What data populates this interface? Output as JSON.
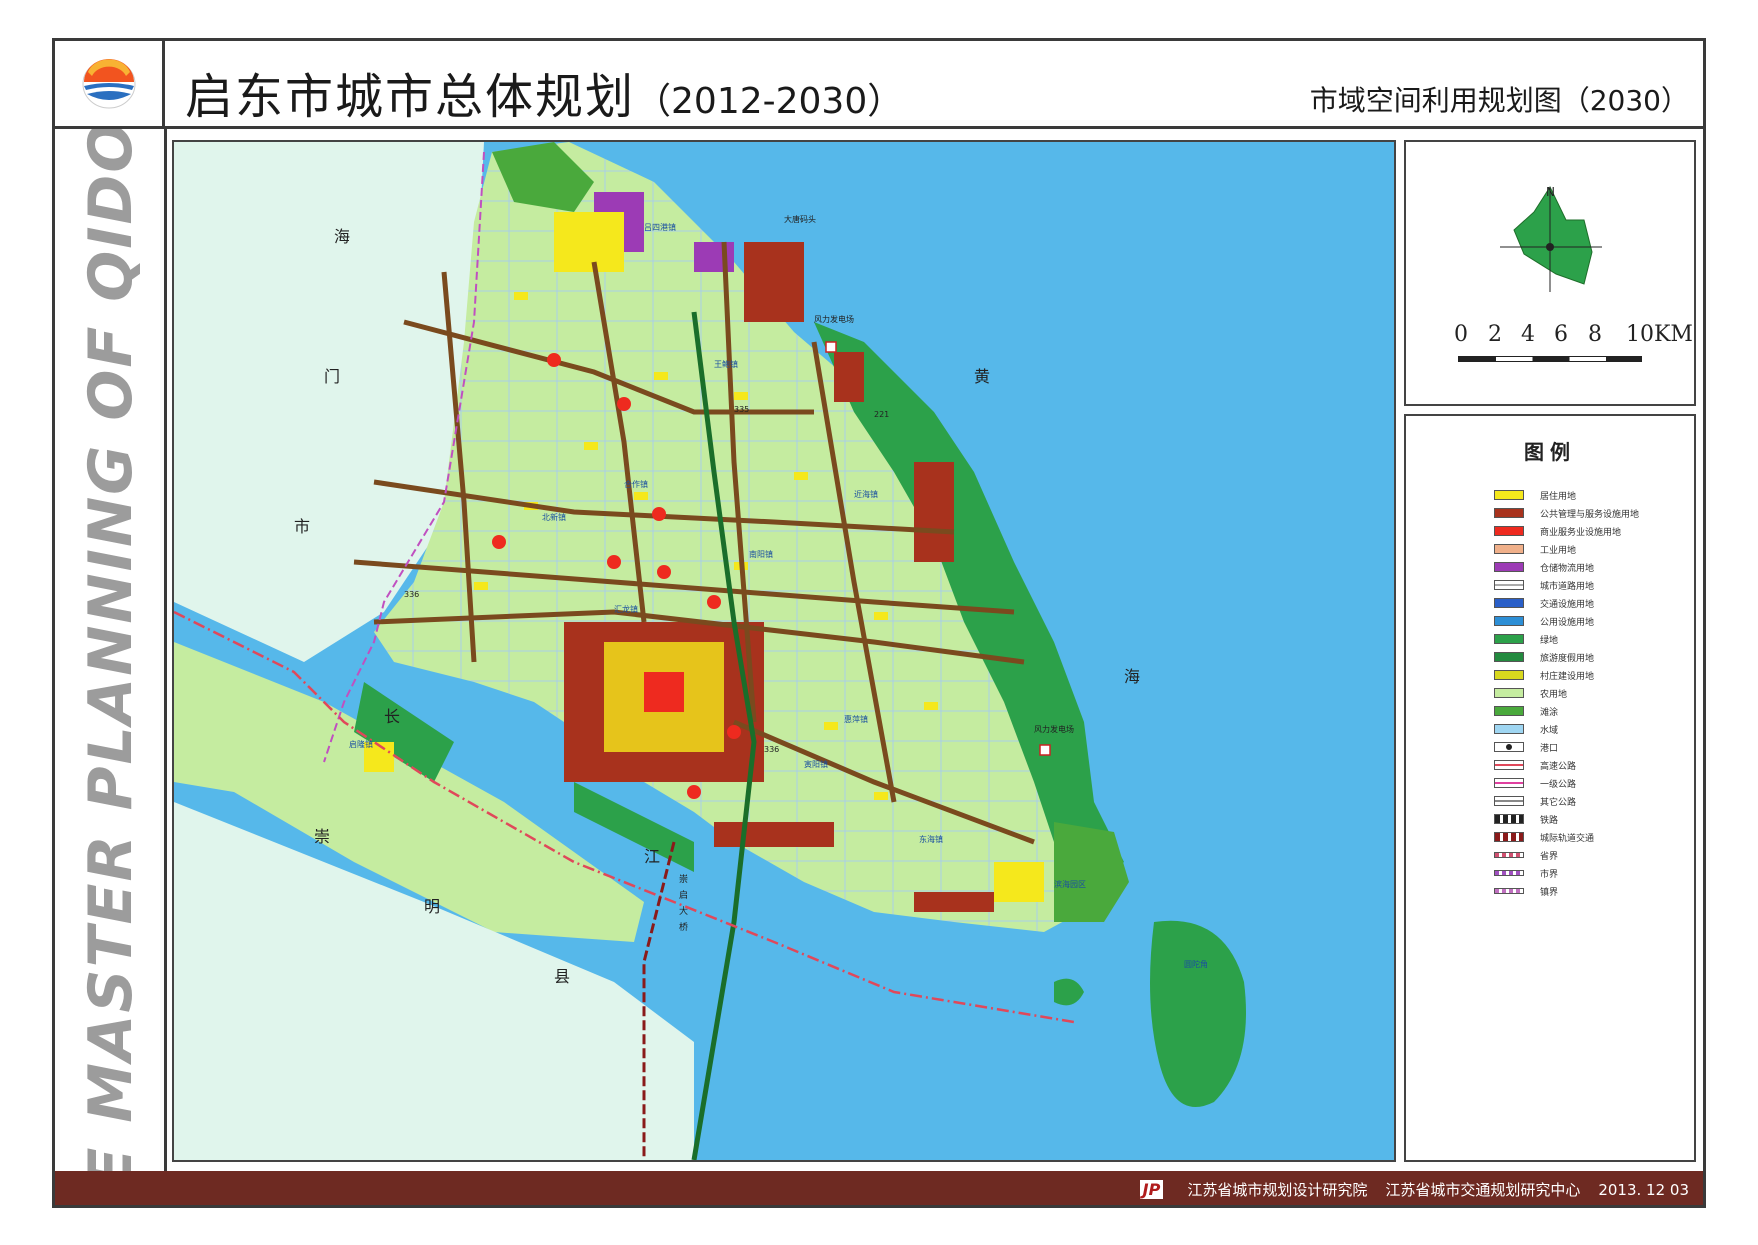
{
  "header": {
    "title": "启东市城市总体规划",
    "years": "（2012-2030）",
    "subtitle": "市域空间利用规划图（2030）"
  },
  "side_banner": "THE MASTER PLANNING OF QIDONG",
  "compass": {
    "north": "N",
    "scale_ticks": [
      "0",
      "2",
      "4",
      "6",
      "8",
      "10KM"
    ]
  },
  "legend": {
    "title": "图例",
    "items": [
      {
        "label": "居住用地",
        "color": "#f5e81c",
        "style": "fill"
      },
      {
        "label": "公共管理与服务设施用地",
        "color": "#a8321d",
        "style": "fill"
      },
      {
        "label": "商业服务业设施用地",
        "color": "#ee2a1f",
        "style": "fill"
      },
      {
        "label": "工业用地",
        "color": "#f0b08a",
        "style": "fill"
      },
      {
        "label": "仓储物流用地",
        "color": "#9c3bb5",
        "style": "fill"
      },
      {
        "label": "城市道路用地",
        "color": "#ffffff",
        "style": "road"
      },
      {
        "label": "交通设施用地",
        "color": "#2a5fc8",
        "style": "fill"
      },
      {
        "label": "公用设施用地",
        "color": "#2d8fd6",
        "style": "fill"
      },
      {
        "label": "绿地",
        "color": "#2ca14a",
        "style": "fill"
      },
      {
        "label": "旅游度假用地",
        "color": "#238a3f",
        "style": "fill"
      },
      {
        "label": "村庄建设用地",
        "color": "#d8d81e",
        "style": "fill"
      },
      {
        "label": "农用地",
        "color": "#c5eca0",
        "style": "fill"
      },
      {
        "label": "滩涂",
        "color": "#4aa93c",
        "style": "fill"
      },
      {
        "label": "水域",
        "color": "#9fd6f2",
        "style": "fill"
      },
      {
        "label": "港口",
        "color": "#ffffff",
        "style": "port"
      },
      {
        "label": "高速公路",
        "color": "#e0485a",
        "style": "line"
      },
      {
        "label": "一级公路",
        "color": "#e040a0",
        "style": "line"
      },
      {
        "label": "其它公路",
        "color": "#888888",
        "style": "line"
      },
      {
        "label": "铁路",
        "color": "#222222",
        "style": "rail"
      },
      {
        "label": "城际轨道交通",
        "color": "#8a1a1a",
        "style": "rail"
      },
      {
        "label": "省界",
        "color": "#d05070",
        "style": "dash"
      },
      {
        "label": "市界",
        "color": "#a050c0",
        "style": "dash"
      },
      {
        "label": "镇界",
        "color": "#c070c0",
        "style": "dash"
      }
    ]
  },
  "map_labels": {
    "haimen": [
      "海",
      "门",
      "市"
    ],
    "chongming": [
      "崇",
      "明",
      "县"
    ],
    "huanghai": [
      "黄",
      "海"
    ],
    "changjiang": [
      "长",
      "江"
    ],
    "bridge": [
      "崇",
      "启",
      "大",
      "桥"
    ],
    "towns": [
      "合作镇",
      "北新镇",
      "南阳镇",
      "吕四港镇",
      "近海镇",
      "王鲍镇",
      "惠萍镇",
      "东海镇",
      "启隆镇",
      "寅阳镇",
      "汇龙镇",
      "滨海园区",
      "圆陀角"
    ],
    "facilities": [
      "大唐码头",
      "风力发电场",
      "风力发电场"
    ],
    "road_numbers": [
      "336",
      "336",
      "335",
      "221"
    ]
  },
  "footer": {
    "logo": "JP",
    "org1": "江苏省城市规划设计研究院",
    "org2": "江苏省城市交通规划研究中心",
    "date": "2013. 12  03"
  }
}
